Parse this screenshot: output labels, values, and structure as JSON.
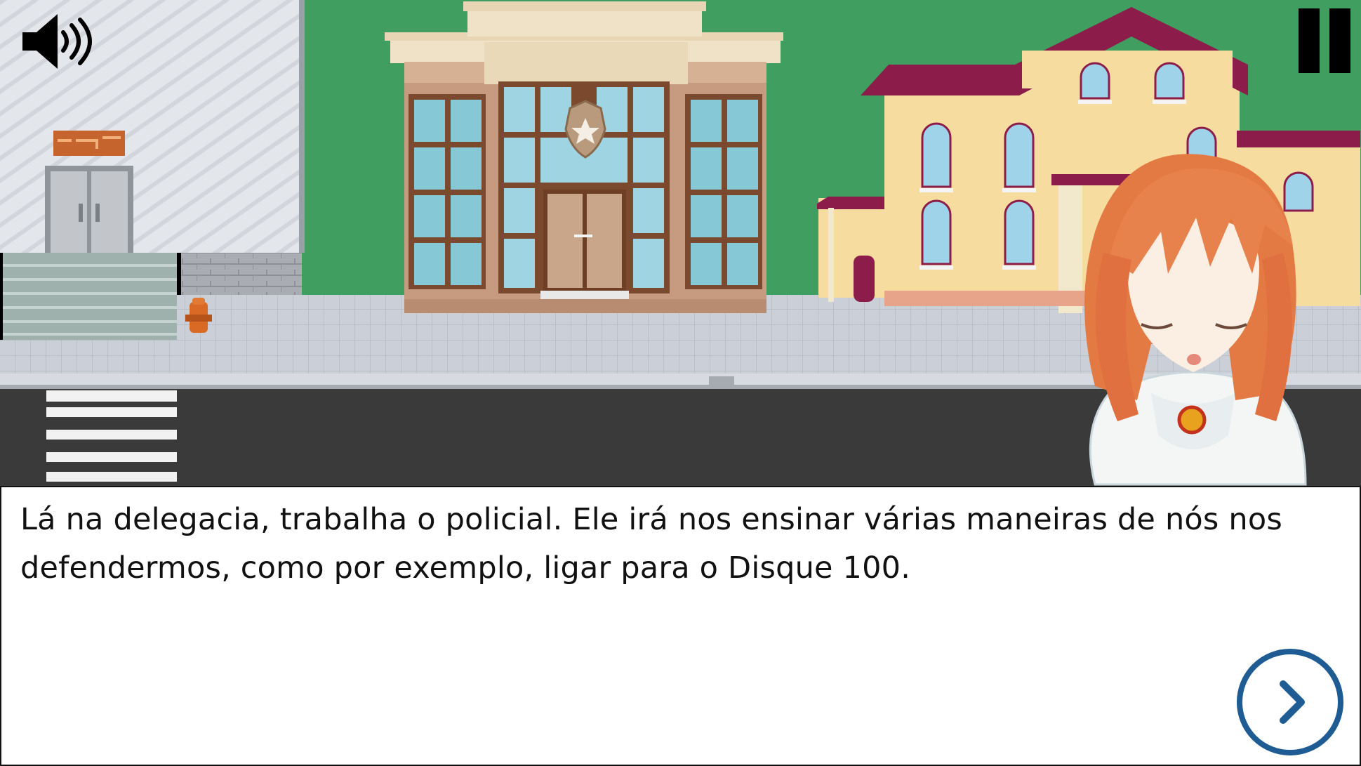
{
  "game": {
    "dialog": {
      "text": "Lá na delegacia, trabalha o policial. Ele irá nos ensinar várias maneiras de nós nos defendermos, como por exemplo, ligar para o Disque 100."
    },
    "controls": {
      "sound_icon": "speaker-icon",
      "pause_icon": "pause-icon",
      "next_icon": "chevron-right-icon"
    },
    "colors": {
      "grass": "#3f9e60",
      "road": "#3a3a3a",
      "sidewalk": "#c9ced6",
      "police_building": "#c79b7f",
      "house_wall": "#f7dca0",
      "house_roof": "#8c1d4b",
      "next_button": "#1f5c94"
    }
  }
}
